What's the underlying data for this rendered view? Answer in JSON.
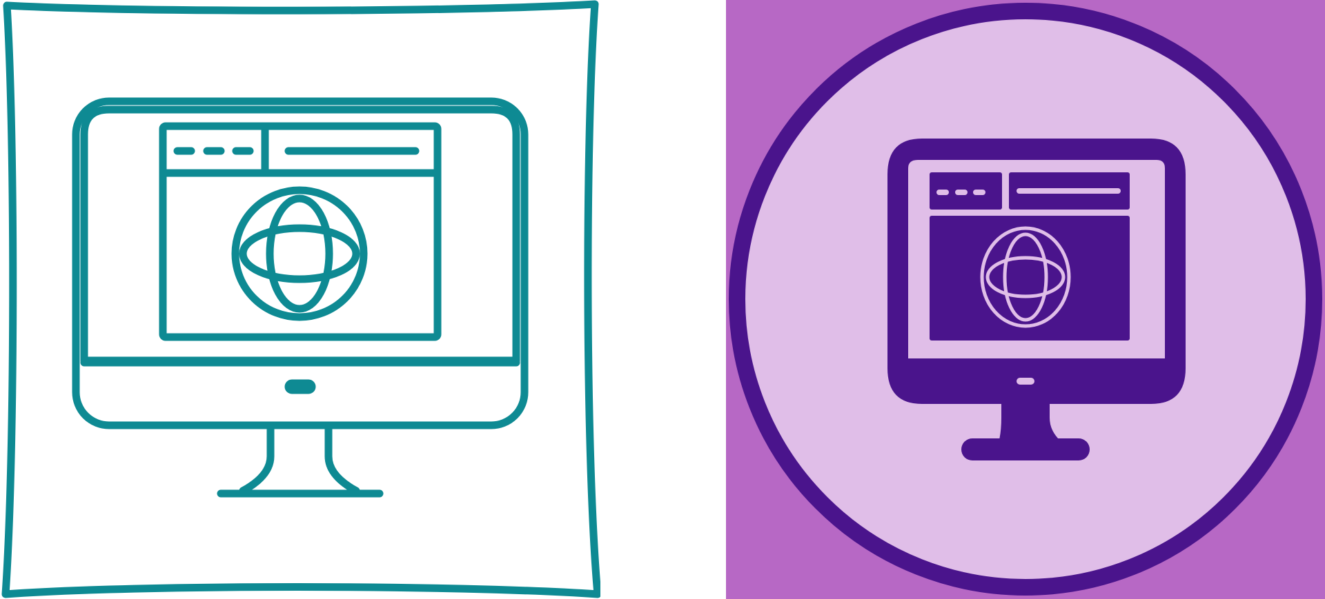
{
  "icons": {
    "left": {
      "name": "web-browser-monitor-icon",
      "style": "line",
      "stroke_color": "#0e8a93",
      "frame_color": "#0e8a93",
      "background": "#ffffff"
    },
    "right": {
      "name": "web-browser-monitor-icon",
      "style": "glyph",
      "background": "#b768c5",
      "circle_fill": "#e0bee8",
      "circle_ring": "#4a148c",
      "glyph_color": "#4a148c",
      "accent_color": "#e0bee8"
    }
  }
}
